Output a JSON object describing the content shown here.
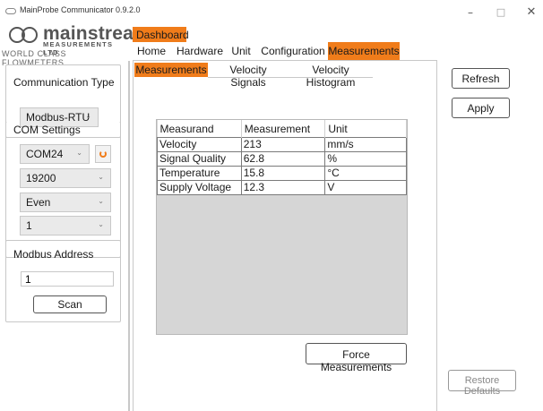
{
  "window": {
    "title": "MainProbe Communicator 0.9.2.0",
    "minimize": "–",
    "maximize": "□",
    "close": "✕"
  },
  "brand": {
    "name": "mainstream",
    "mark": "™",
    "subtitle": "MEASUREMENTS LTD",
    "tagline": "WORLD CLASS FLOWMETERS",
    "color": "#555555"
  },
  "accent_color": "#f07c1a",
  "sidebar": {
    "communication_type": {
      "title": "Communication Type",
      "selected": "Modbus-RTU"
    },
    "com_settings": {
      "title": "COM Settings",
      "port": "COM24",
      "baud_rate": "19200",
      "parity": "Even",
      "stop_bits": "1"
    },
    "modbus_address": {
      "title": "Modbus Address",
      "value": "1",
      "scan_label": "Scan"
    }
  },
  "dashboard_tab": "Dashboard",
  "main_tabs": [
    {
      "label": "Home",
      "active": false
    },
    {
      "label": "Hardware",
      "active": false
    },
    {
      "label": "Unit",
      "active": false
    },
    {
      "label": "Configuration",
      "active": false
    },
    {
      "label": "Measurements",
      "active": true
    }
  ],
  "sub_tabs": [
    {
      "label": "Measurements",
      "active": true
    },
    {
      "label": "Velocity Signals",
      "active": false
    },
    {
      "label": "Velocity Histogram",
      "active": false
    }
  ],
  "measurements_table": {
    "headers": [
      "Measurand",
      "Measurement",
      "Unit"
    ],
    "rows": [
      [
        "Velocity",
        "213",
        "mm/s"
      ],
      [
        "Signal Quality",
        "62.8",
        "%"
      ],
      [
        "Temperature",
        "15.8",
        "°C"
      ],
      [
        "Supply Voltage",
        "12.3",
        "V"
      ]
    ]
  },
  "actions": {
    "force_measurements": "Force Measurements",
    "refresh": "Refresh",
    "apply": "Apply",
    "restore_defaults": "Restore Defaults"
  }
}
